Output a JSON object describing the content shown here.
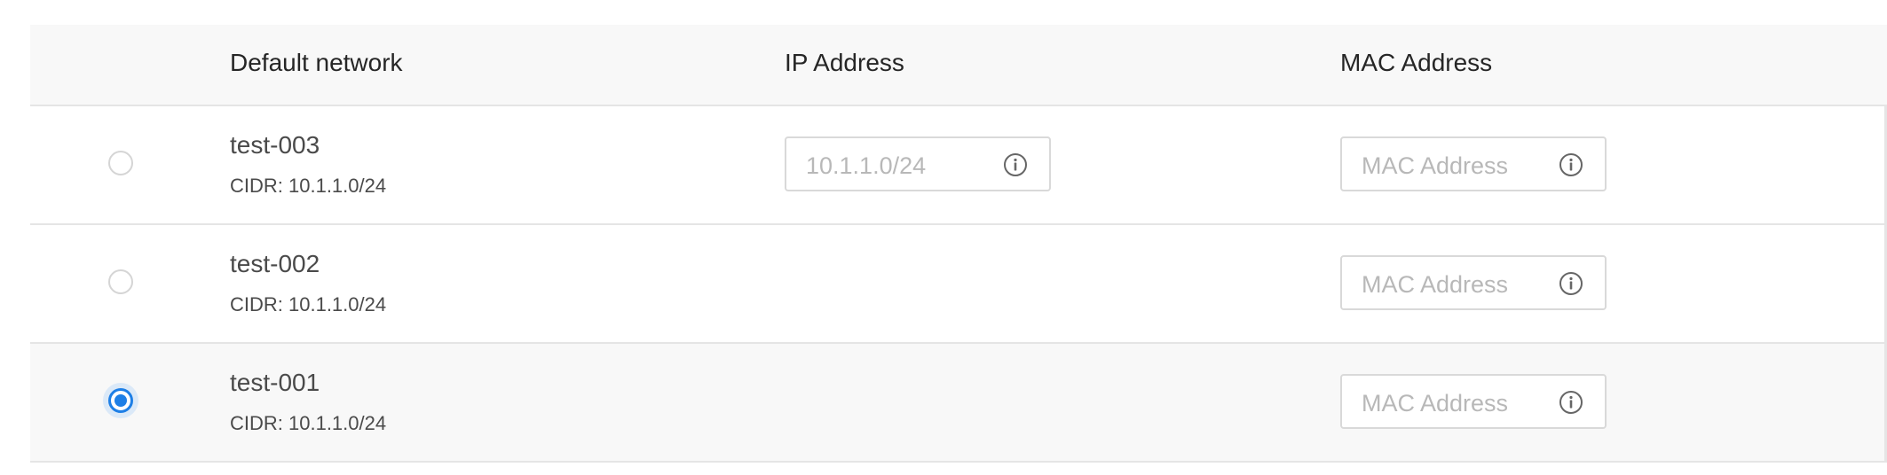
{
  "header": {
    "default_network": "Default network",
    "ip_address": "IP Address",
    "mac_address": "MAC Address"
  },
  "rows": [
    {
      "name": "test-003",
      "cidr": "CIDR: 10.1.1.0/24",
      "selected": false,
      "ip_placeholder": "10.1.1.0/24",
      "mac_placeholder": "MAC Address"
    },
    {
      "name": "test-002",
      "cidr": "CIDR: 10.1.1.0/24",
      "selected": false,
      "mac_placeholder": "MAC Address"
    },
    {
      "name": "test-001",
      "cidr": "CIDR: 10.1.1.0/24",
      "selected": true,
      "mac_placeholder": "MAC Address"
    }
  ],
  "icons": {
    "info": "info-icon",
    "radio": "radio-button"
  },
  "colors": {
    "accent": "#1e7fe6",
    "header_bg": "#f8f8f8",
    "border": "#e5e5e5"
  }
}
